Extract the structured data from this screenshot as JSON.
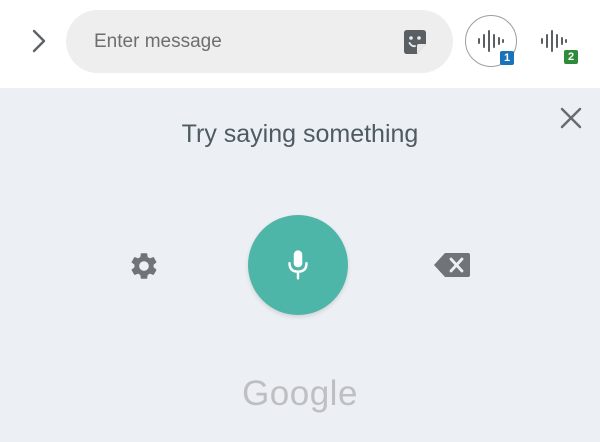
{
  "compose": {
    "message_placeholder": "Enter message",
    "sticker_icon": "sticker-icon",
    "voice_buttons": [
      {
        "icon": "voice-waveform-icon",
        "badge": "1",
        "badge_color": "#1a73b8",
        "selected": true
      },
      {
        "icon": "voice-waveform-icon",
        "badge": "2",
        "badge_color": "#2e8b3a",
        "selected": false
      }
    ]
  },
  "voice_panel": {
    "prompt": "Try saying something",
    "brand": "Google",
    "mic_color": "#4db6a8",
    "background": "#eceff3",
    "icons": {
      "close": "close-icon",
      "settings": "gear-icon",
      "mic": "microphone-icon",
      "backspace": "backspace-icon"
    }
  }
}
